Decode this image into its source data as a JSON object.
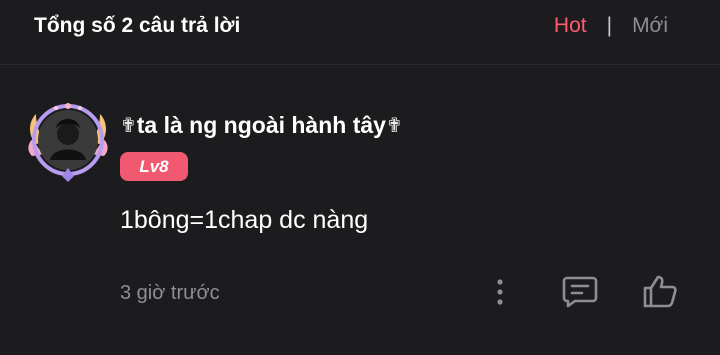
{
  "header": {
    "title": "Tổng số 2 câu trả lời",
    "sort_hot": "Hot",
    "separator": "|",
    "sort_new": "Mới"
  },
  "comment": {
    "username_prefix": "✟",
    "username": "ta là ng ngoài hành tây",
    "username_suffix": "✟",
    "level": "Lv8",
    "text": "1bông=1chap dc nàng",
    "time": "3 giờ trước"
  },
  "colors": {
    "accent": "#ff5a6e",
    "level_badge": "#f0596f",
    "background": "#1c1c1e",
    "muted": "#8e8e93"
  },
  "icons": {
    "more": "more-vertical-icon",
    "reply": "comment-icon",
    "like": "thumbs-up-icon"
  }
}
